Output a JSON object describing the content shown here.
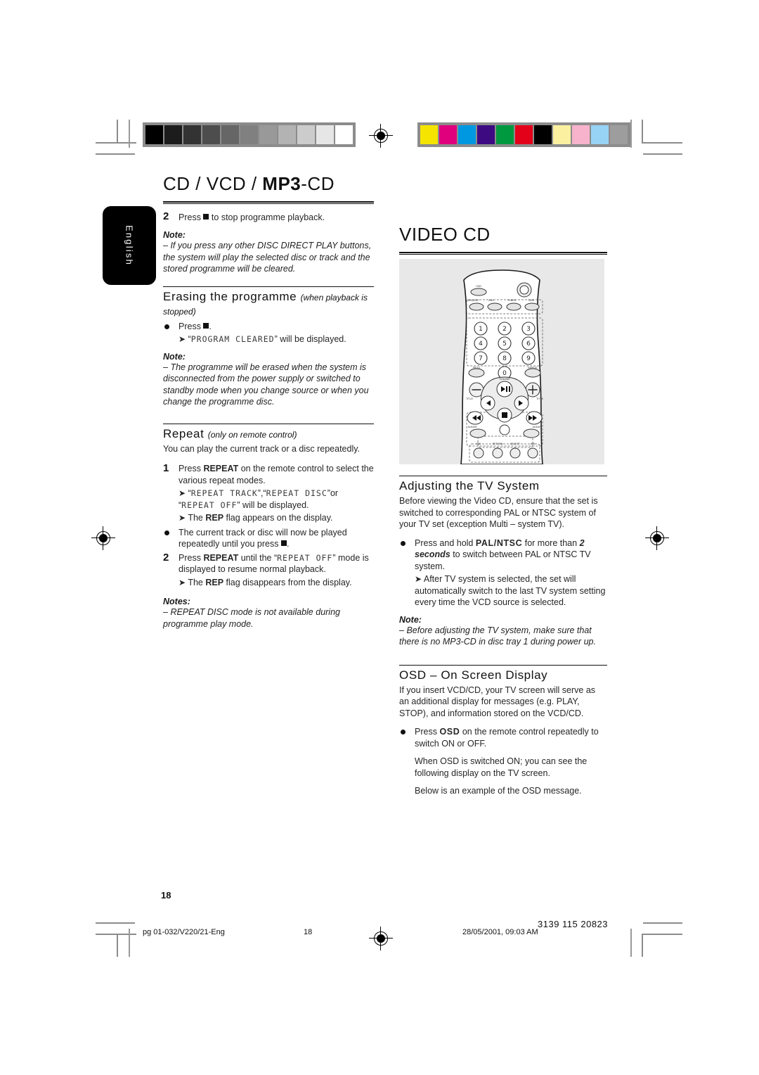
{
  "meta": {
    "language_tab": "English",
    "page_number": "18"
  },
  "calibration": {
    "gray_bar": [
      "#000000",
      "#1c1c1c",
      "#333333",
      "#4d4d4d",
      "#666666",
      "#808080",
      "#999999",
      "#b3b3b3",
      "#cccccc",
      "#e6e6e6",
      "#ffffff"
    ],
    "color_bar": [
      "#f5e400",
      "#e0007d",
      "#0098e0",
      "#3d0a82",
      "#00993f",
      "#e30019",
      "#000000",
      "#faf0a0",
      "#f7b3cb",
      "#97d3f5",
      "#9d9d9d"
    ]
  },
  "left_column": {
    "chapter_title_a": "CD / VCD / ",
    "chapter_title_b": "MP3",
    "chapter_title_c": "-CD",
    "step2": {
      "num": "2",
      "text_before": "Press",
      "text_after": "to stop programme playback."
    },
    "note1": {
      "label": "Note:",
      "dash": "–",
      "body": "If you press any other DISC DIRECT PLAY buttons, the system will play the selected disc or track and the stored programme will be cleared."
    },
    "erasing": {
      "heading": "Erasing the programme",
      "heading_italic": "(when playback is stopped)",
      "bullet_press": "Press",
      "arrow_line_prefix": "“",
      "arrow_line_lcd": "PROGRAM CLEARED",
      "arrow_line_suffix": "” will be displayed.",
      "note_label": "Note:",
      "note_dash": "–",
      "note_body": "The programme will be erased when the system is disconnected from the power supply or switched to standby mode when you change source or when you change the programme disc."
    },
    "repeat": {
      "heading": "Repeat",
      "heading_italic": "(only on remote control)",
      "intro": "You can play the current track or a disc repeatedly.",
      "step1_num": "1",
      "step1_a": "Press",
      "step1_key": "REPEAT",
      "step1_b": "on the remote control to select the various repeat modes.",
      "step1_arrow_lcd1": "REPEAT TRACK",
      "step1_arrow_lcd2": "REPEAT DISC",
      "step1_arrow_or": "or",
      "step1_arrow_lcd3": "REPEAT OFF",
      "step1_arrow_tail": "” will be displayed.",
      "step1_arrow2_a": "The",
      "step1_arrow2_key": "REP",
      "step1_arrow2_b": "flag appears on the display.",
      "bullet_a": "The current track or disc will now be played repeatedly until you press",
      "step2_num": "2",
      "step2_a": "Press",
      "step2_key": "REPEAT",
      "step2_b": "until the",
      "step2_lcd": "REPEAT OFF",
      "step2_c": "” mode is displayed to resume normal playback.",
      "step2_arrow_a": "The",
      "step2_arrow_key": "REP",
      "step2_arrow_b": "flag disappears from the display.",
      "notes_label": "Notes:",
      "notes_dash": "–",
      "notes_body": "REPEAT DISC mode is not available during programme play mode."
    }
  },
  "right_column": {
    "chapter_title": "VIDEO CD",
    "remote_image_alt": "remote-control-illustration",
    "tv_system": {
      "heading": "Adjusting the TV System",
      "intro": "Before viewing the Video CD, ensure that the set is switched to corresponding PAL or NTSC system of your TV set (exception Multi – system TV).",
      "bullet_a": "Press and hold",
      "bullet_key": "PAL/NTSC",
      "bullet_b": "for more than",
      "bullet_bold1": "2 seconds",
      "bullet_c": "to switch between PAL or NTSC TV system.",
      "arrow_body": "After TV system is selected, the set will automatically switch to the last TV system setting every time the VCD source is selected.",
      "note_label": "Note:",
      "note_dash": "–",
      "note_body": "Before adjusting the TV system, make sure that there is no MP3-CD in disc tray 1 during power up."
    },
    "osd": {
      "heading": "OSD – On Screen Display",
      "intro": "If you insert VCD/CD, your TV screen will serve as an additional display for messages (e.g. PLAY, STOP), and information stored on the VCD/CD.",
      "bullet_a": "Press",
      "bullet_key": "OSD",
      "bullet_b": "on the remote control repeatedly to switch ON or OFF.",
      "para2": "When OSD is switched ON; you can see the following display on the TV screen.",
      "para3": "Below is an example of the OSD message."
    }
  },
  "footer": {
    "file": "pg 01-032/V220/21-Eng",
    "page": "18",
    "date": "28/05/2001, 09:03 AM",
    "code": "3139 115 20823"
  }
}
